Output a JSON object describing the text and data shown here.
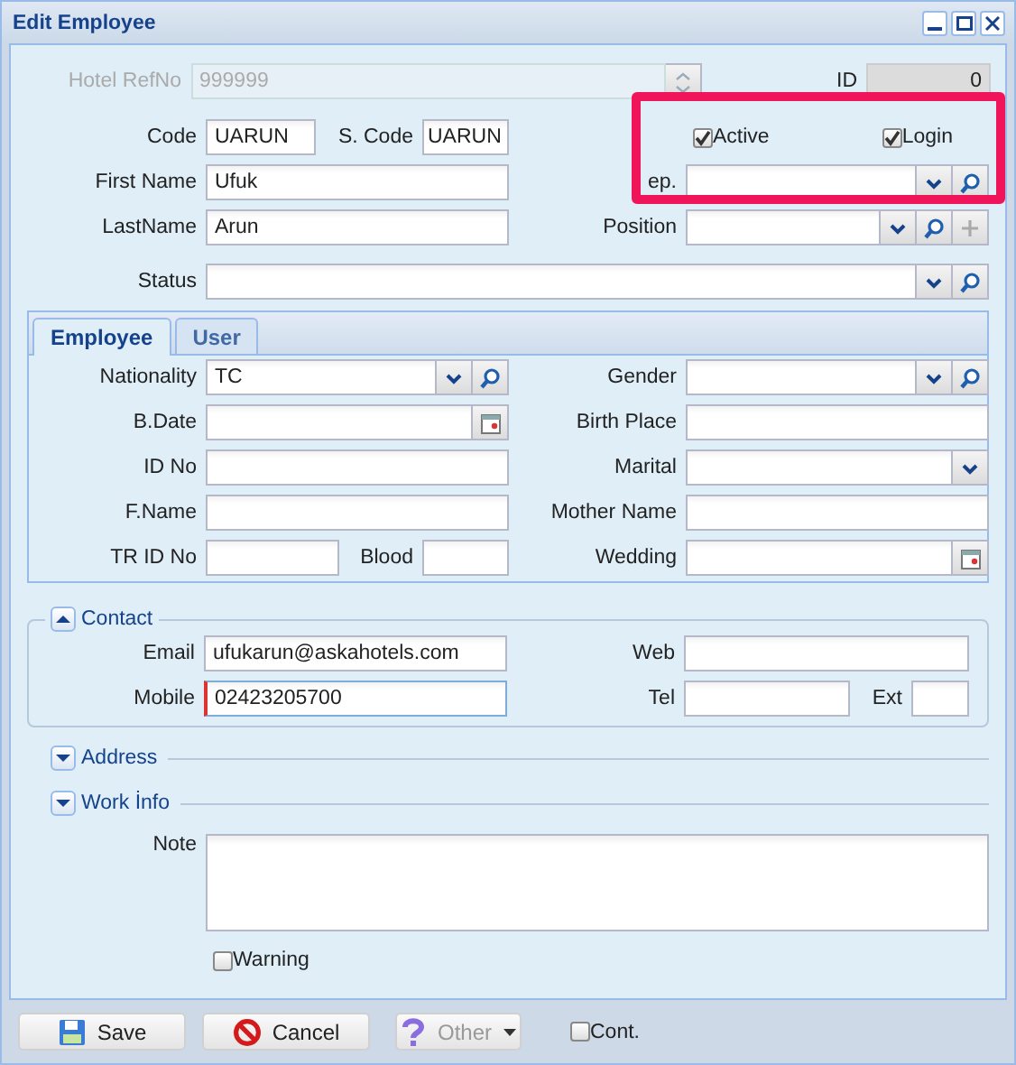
{
  "window": {
    "title": "Edit Employee"
  },
  "header": {
    "hotel_ref": {
      "label": "Hotel RefNo",
      "value": "999999",
      "kind": "spinner",
      "disabled": true
    },
    "id": {
      "label": "ID",
      "value": "0",
      "kind": "readonly"
    },
    "rows": [
      [
        [
          {
            "label": "Code",
            "value": "UARUN",
            "kind": "text"
          },
          {
            "label": "S. Code",
            "value": "UARUN",
            "kind": "text"
          }
        ],
        [
          {
            "kind": "checkbox",
            "label": "Active",
            "checked": true
          },
          {
            "kind": "checkbox",
            "label": "Login",
            "checked": true
          }
        ]
      ],
      [
        [
          {
            "label": "First Name",
            "value": "Ufuk",
            "kind": "text"
          }
        ],
        [
          {
            "label": "ep.",
            "kind": "combo"
          }
        ]
      ],
      [
        [
          {
            "label": "LastName",
            "value": "Arun",
            "kind": "text"
          }
        ],
        [
          {
            "label": "Position",
            "kind": "combo_add"
          }
        ]
      ],
      [
        [
          {
            "label": "Status",
            "kind": "combo"
          }
        ]
      ]
    ]
  },
  "tabs": [
    {
      "label": "Employee",
      "selected": true
    },
    {
      "label": "User",
      "selected": false
    }
  ],
  "employee": {
    "rows": [
      [
        [
          {
            "label": "Nationality",
            "value": "TC",
            "kind": "combo"
          }
        ],
        [
          {
            "label": "Gender",
            "kind": "combo"
          }
        ]
      ],
      [
        [
          {
            "label": "B.Date",
            "kind": "date"
          }
        ],
        [
          {
            "label": "Birth Place",
            "kind": "text"
          }
        ]
      ],
      [
        [
          {
            "label": "ID No",
            "kind": "text"
          }
        ],
        [
          {
            "label": "Marital",
            "kind": "select"
          }
        ]
      ],
      [
        [
          {
            "label": "F.Name",
            "kind": "text"
          }
        ],
        [
          {
            "label": "Mother Name",
            "kind": "text"
          }
        ]
      ],
      [
        [
          {
            "label": "TR ID No",
            "kind": "text"
          },
          {
            "label": "Blood",
            "kind": "text"
          }
        ],
        [
          {
            "label": "Wedding",
            "kind": "date"
          }
        ]
      ]
    ]
  },
  "sections": [
    {
      "title": "Contact",
      "expanded": true,
      "rows": [
        [
          [
            {
              "label": "Email",
              "value": "ufukarun@askahotels.com",
              "kind": "text",
              "focused": false
            }
          ],
          [
            {
              "label": "Web",
              "kind": "text",
              "focused": false
            }
          ]
        ],
        [
          [
            {
              "label": "Mobile",
              "value": "02423205700",
              "kind": "text",
              "focused": true
            }
          ],
          [
            {
              "label": "Tel",
              "kind": "text",
              "focused": false
            },
            {
              "label": "Ext",
              "kind": "text",
              "focused": false
            }
          ]
        ]
      ]
    },
    {
      "title": "Address",
      "expanded": false
    },
    {
      "title": "Work İnfo",
      "expanded": false
    }
  ],
  "note": {
    "label": "Note"
  },
  "warning": {
    "label": "Warning",
    "checked": false
  },
  "toolbar": {
    "buttons": [
      {
        "label": "Save",
        "kind": "save",
        "disabled": false
      },
      {
        "label": "Cancel",
        "kind": "cancel",
        "disabled": false
      },
      {
        "label": "Other",
        "kind": "other",
        "disabled": true
      }
    ],
    "cont": {
      "label": "Cont.",
      "checked": false
    }
  }
}
